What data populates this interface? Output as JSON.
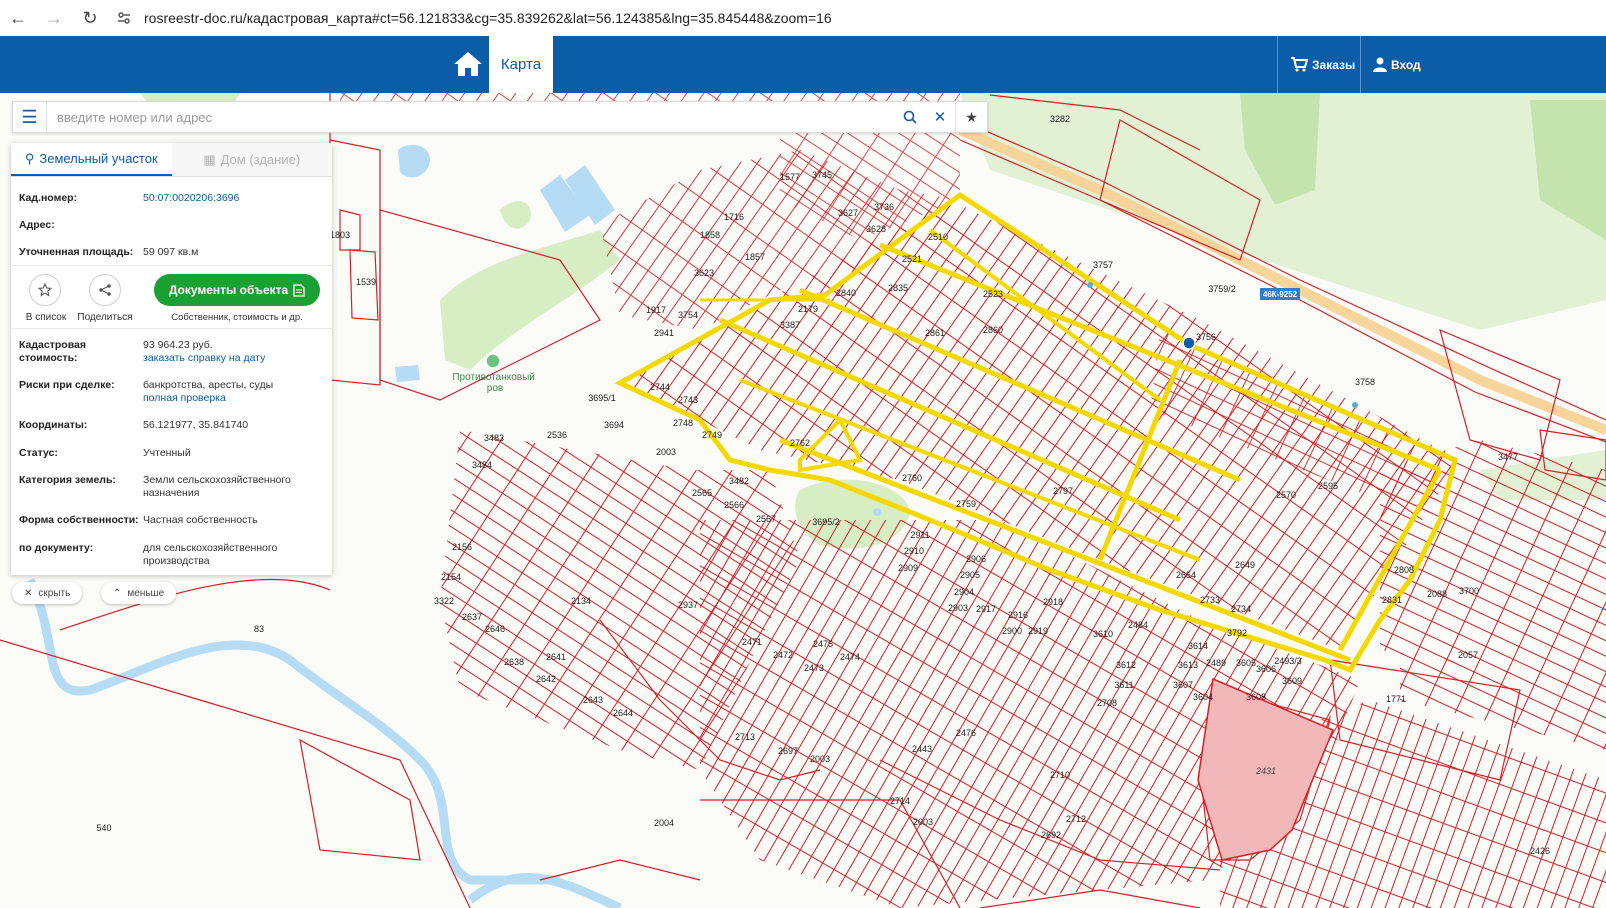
{
  "browser": {
    "url": "rosreestr-doc.ru/кадастровая_карта#ct=56.121833&cg=35.839262&lat=56.124385&lng=35.845448&zoom=16"
  },
  "header": {
    "map_tab": "Карта",
    "orders": "Заказы",
    "login": "Вход"
  },
  "search": {
    "placeholder": "введите номер или адрес"
  },
  "panel": {
    "tab_land": "Земельный участок",
    "tab_house": "Дом (здание)",
    "cad_label": "Кад.номер:",
    "cad_value": "50:07:0020206:3696",
    "address_label": "Адрес:",
    "address_value": "",
    "area_label": "Уточненная площадь:",
    "area_value": "59 097 кв.м",
    "list_label": "В список",
    "share_label": "Поделиться",
    "docs_button": "Документы объекта",
    "docs_sub": "Собственник, стоимость и др.",
    "cost_label_1": "Кадастровая",
    "cost_label_2": "стоимость:",
    "cost_value": "93 964.23 руб.",
    "cost_link": "заказать справку на дату",
    "risk_label": "Риски при сделке:",
    "risk_value": "банкротства, аресты, суды",
    "risk_link": "полная проверка",
    "coord_label": "Координаты:",
    "coord_value": "56.121977, 35.841740",
    "status_label": "Статус:",
    "status_value": "Учтенный",
    "cat_label": "Категория земель:",
    "cat_value_1": "Земли сельскохозяйственного",
    "cat_value_2": "назначения",
    "own_label": "Форма собственности:",
    "own_value": "Частная собственность",
    "doc_label": "по документу:",
    "doc_value_1": "для сельскохозяйственного",
    "doc_value_2": "производства",
    "hide": "скрыть",
    "less": "меньше"
  },
  "map": {
    "colors": {
      "parcel": "#d61f26",
      "selected": "#f5d800",
      "green": "#d7edc4",
      "water": "#b5dcf4",
      "highlight": "#f2b7b9"
    },
    "place_label": "Противотанковый ров",
    "road_label": "46К-9252",
    "labels": {
      "l3282": "3282",
      "l3757": "3757",
      "l3759": "3759/2",
      "l3756": "3756",
      "l3758": "3758",
      "l3477": "3477",
      "l3745": "3745",
      "l3736": "3736",
      "l3627": "3627",
      "l3628": "3628",
      "l1577": "1577",
      "l1716": "1716",
      "l1858": "1858",
      "l1857": "1857",
      "l3623": "3623",
      "l1917": "1917",
      "l2941": "2941",
      "l3754": "3754",
      "l1539": "1539",
      "l1803": "1803",
      "l3695_1": "3695/1",
      "l3694": "3694",
      "l2536": "2536",
      "l2003": "2003",
      "l3483": "3483",
      "l3484": "3484",
      "l2156": "2156",
      "l2154": "2154",
      "l3322": "3322",
      "l83": "83",
      "l540": "540",
      "l2004": "2004",
      "l2003b": "2003",
      "l2431": "2431",
      "l1771": "1771",
      "l3792": "3792",
      "l3695_2": "3695/2",
      "l3609": "3609",
      "l2088": "2088",
      "l3700": "3700",
      "l2057": "2057",
      "l2521": "2521",
      "l2510": "2510",
      "l2523": "2523",
      "l2840": "2840",
      "l2835": "2835",
      "l2861": "2861",
      "l2860": "2860",
      "l3387": "3387",
      "l2179": "2179",
      "l2744": "2744",
      "l2743": "2743",
      "l2748": "2748",
      "l2749": "2749",
      "l2762": "2762",
      "l2565": "2565",
      "l2566": "2566",
      "l2567": "2567",
      "l3482": "3482",
      "l2759": "2759",
      "l2760": "2760",
      "l2797": "2797",
      "l2570": "2570",
      "l2595": "2595",
      "l2808": "2808",
      "l2831": "2831",
      "l2733": "2733",
      "l2734": "2734",
      "l2654": "2654",
      "l2649": "2649",
      "l2134": "2134",
      "l2937": "2937",
      "l2471": "2471",
      "l2472": "2472",
      "l2473": "2473",
      "l2474": "2474",
      "l2475": "2475",
      "l2713": "2713",
      "l2697": "2697",
      "l2003c": "2003",
      "l2714": "2714",
      "l2710": "2710",
      "l2712": "2712",
      "l2692": "2692",
      "l2708": "2708",
      "l2641": "2641",
      "l2642": "2642",
      "l2643": "2643",
      "l2644": "2644",
      "l2646": "2646",
      "l2637": "2637",
      "l2638": "2638",
      "l2911": "2911",
      "l2910": "2910",
      "l2909": "2909",
      "l2906": "2906",
      "l2905": "2905",
      "l2904": "2904",
      "l2903": "2903",
      "l2917": "2917",
      "l2916": "2916",
      "l2918": "2918",
      "l2900": "2900",
      "l2919": "2919",
      "l3610": "3610",
      "l2484": "2484",
      "l3612": "3612",
      "l3613": "3613",
      "l3614": "3614",
      "l2489": "2489",
      "l3607": "3607",
      "l3608": "3608",
      "l3605": "3605",
      "l3606": "3606",
      "l2493": "2493/3",
      "l3611": "3611",
      "l3604": "3604",
      "l2476": "2476",
      "l2443": "2443",
      "l2426": "2426"
    }
  }
}
